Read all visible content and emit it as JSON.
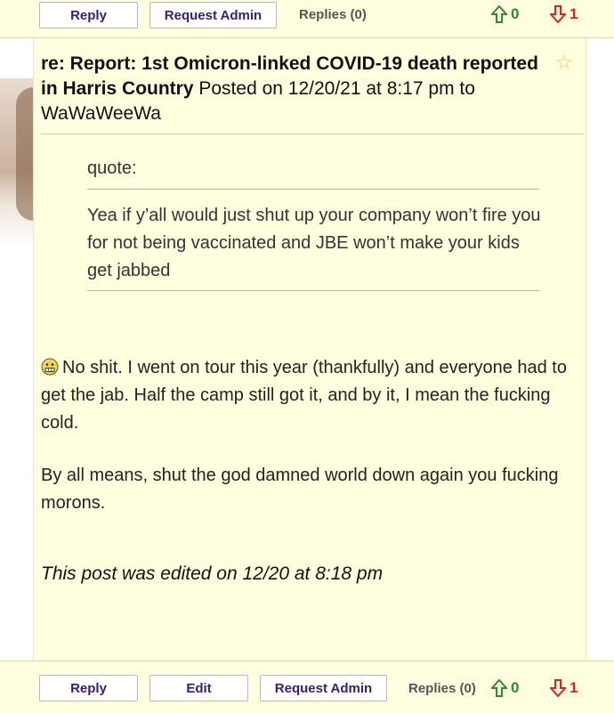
{
  "top_bar": {
    "reply_label": "Reply",
    "request_admin_label": "Request Admin",
    "replies_label": "Replies (0)",
    "upvotes": "0",
    "downvotes": "1"
  },
  "post": {
    "title": "re: Report: 1st Omicron-linked COVID-19 death reported in Harris Country",
    "meta": "Posted on 12/20/21 at 8:17 pm to WaWaWeeWa",
    "quote_label": "quote:",
    "quote_text": "Yea if y’all would just shut up your company won’t fire you for not being vaccinated and JBE won’t make your kids get jabbed",
    "paragraph1": "No shit. I went on tour this year (thankfully) and everyone had to get the jab. Half the camp still got it, and by it, I mean the fucking cold.",
    "paragraph2": "By all means, shut the god damned world down again you fucking morons.",
    "edited_note": "This post was edited on 12/20 at 8:18 pm",
    "favorite_icon": "star-icon",
    "smiley_icon": "grimace-smiley-icon"
  },
  "bottom_bar": {
    "reply_label": "Reply",
    "edit_label": "Edit",
    "request_admin_label": "Request Admin",
    "replies_label": "Replies (0)",
    "upvotes": "0",
    "downvotes": "1"
  },
  "colors": {
    "post_background": "#ffffe0",
    "button_text": "#3a1d73",
    "upvote": "#2e8b2e",
    "downvote": "#dd2222"
  }
}
